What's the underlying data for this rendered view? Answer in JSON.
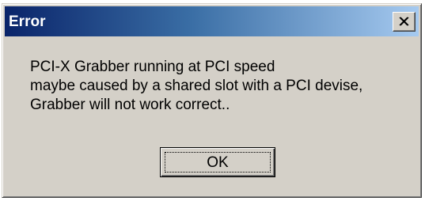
{
  "window": {
    "title": "Error",
    "close_icon": "close-icon"
  },
  "message": {
    "lines": [
      "PCI-X Grabber running at PCI speed",
      "maybe caused by a shared slot with a PCI devise,",
      "Grabber will not work correct.."
    ]
  },
  "buttons": {
    "ok_label": "OK"
  },
  "colors": {
    "titlebar_start": "#0a246a",
    "titlebar_end": "#a6caf0",
    "dialog_face": "#d4d0c8"
  }
}
